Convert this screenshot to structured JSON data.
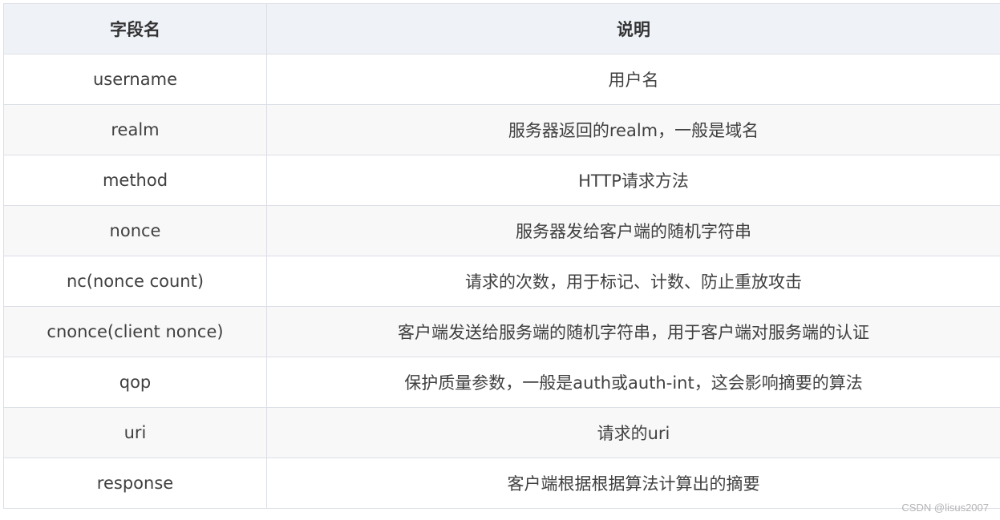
{
  "table": {
    "headers": [
      "字段名",
      "说明"
    ],
    "rows": [
      {
        "field": "username",
        "desc": "用户名"
      },
      {
        "field": "realm",
        "desc": "服务器返回的realm，一般是域名"
      },
      {
        "field": "method",
        "desc": "HTTP请求方法"
      },
      {
        "field": "nonce",
        "desc": "服务器发给客户端的随机字符串"
      },
      {
        "field": "nc(nonce count)",
        "desc": "请求的次数，用于标记、计数、防止重放攻击"
      },
      {
        "field": "cnonce(client nonce)",
        "desc": "客户端发送给服务端的随机字符串，用于客户端对服务端的认证"
      },
      {
        "field": "qop",
        "desc": "保护质量参数，一般是auth或auth-int，这会影响摘要的算法"
      },
      {
        "field": "uri",
        "desc": "请求的uri"
      },
      {
        "field": "response",
        "desc": "客户端根据根据算法计算出的摘要"
      }
    ]
  },
  "watermark": "CSDN @lisus2007"
}
